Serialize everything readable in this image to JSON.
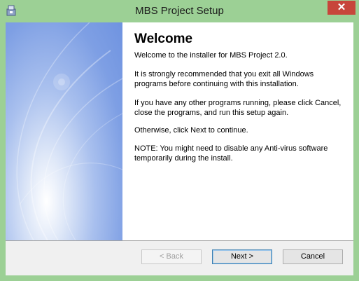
{
  "window": {
    "title": "MBS Project Setup",
    "close_symbol": "✕",
    "icon": "installer-icon"
  },
  "content": {
    "heading": "Welcome",
    "paragraphs": [
      "Welcome to the installer for MBS Project 2.0.",
      "It is strongly recommended that you exit all Windows programs before continuing with this installation.",
      "If you have any other programs running, please click Cancel, close the programs, and run this setup again.",
      "Otherwise, click Next to continue.",
      "NOTE: You might need to disable any Anti-virus software temporarily during the install."
    ]
  },
  "buttons": {
    "back_label": "< Back",
    "next_label": "Next >",
    "cancel_label": "Cancel"
  },
  "colors": {
    "frame": "#9cd095",
    "close_button": "#c7463b",
    "banner": "#7e9fe4"
  }
}
